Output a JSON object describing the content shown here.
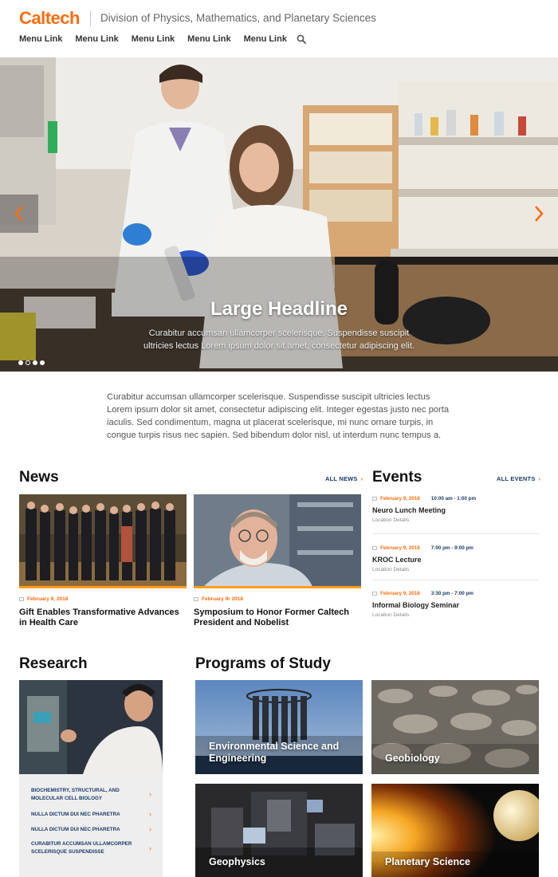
{
  "header": {
    "logo": "Caltech",
    "division": "Division of Physics, Mathematics, and Planetary Sciences",
    "nav": [
      "Menu Link",
      "Menu Link",
      "Menu Link",
      "Menu Link",
      "Menu Link"
    ],
    "search_icon": "search-icon"
  },
  "hero": {
    "headline": "Large Headline",
    "subtext": "Curabitur accumsan ullamcorper scelerisque. Suspendisse suscipit ultricies lectus Lorem ipsum dolor sit amet, consectetur adipiscing elit.",
    "slide_active": 1,
    "slide_count": 4
  },
  "intro": "Curabitur accumsan ullamcorper scelerisque. Suspendisse suscipit ultricies lectus Lorem ipsum dolor sit amet, consectetur adipiscing elit. Integer egestas justo nec porta iaculis. Sed condimentum, magna ut placerat scelerisque, mi nunc ornare turpis, in congue turpis risus nec sapien. Sed bibendum dolor nisl, ut interdum nunc tempus a.",
  "news": {
    "title": "News",
    "all_label": "ALL NEWS",
    "items": [
      {
        "date": "February 9, 2018",
        "title": "Gift Enables Transformative Advances in Health Care"
      },
      {
        "date": "February 9r 2018",
        "title": "Symposium to Honor Former Caltech President and Nobelist"
      }
    ]
  },
  "events": {
    "title": "Events",
    "all_label": "ALL EVENTS",
    "items": [
      {
        "date": "February 9, 2018",
        "time": "10:00 am - 1:00 pm",
        "name": "Neuro Lunch Meeting",
        "location": "Location Details"
      },
      {
        "date": "February 9, 2018",
        "time": "7:00 pm - 9:00 pm",
        "name": "KROC Lecture",
        "location": "Location Details"
      },
      {
        "date": "February 9, 2018",
        "time": "3:30 pm - 7:00 pm",
        "name": "Informal Biology Seminar",
        "location": "Location Details"
      }
    ]
  },
  "research": {
    "title": "Research",
    "items": [
      "BIOCHEMISTRY, STRUCTURAL, AND MOLECULAR CELL BIOLOGY",
      "NULLA DICTUM DUI NEC PHARETRA",
      "NULLA DICTUM DUI NEC PHARETRA",
      "CURABITUR ACCUMSAN ULLAMCORPER SCELERISQUE SUSPENDISSE"
    ]
  },
  "programs": {
    "title": "Programs of Study",
    "items": [
      "Environmental Science and Engineering",
      "Geobiology",
      "Geophysics",
      "Planetary Science"
    ]
  },
  "colors": {
    "brand_orange": "#ff6c0c",
    "link_navy": "#1a3a6b"
  }
}
